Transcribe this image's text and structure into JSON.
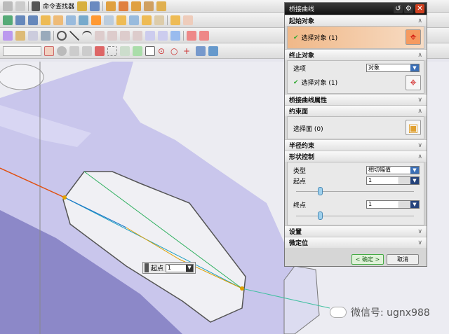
{
  "toolbar": {
    "command_finder": "命令查找器"
  },
  "dialog": {
    "title": "桥接曲线",
    "sections": {
      "start_object": "起始对象",
      "end_object": "终止对象",
      "bridge_props": "桥接曲线属性",
      "constraint_face": "约束面",
      "radius_constraint": "半径约束",
      "shape_control": "形状控制",
      "settings": "设置",
      "fine_position": "微定位"
    },
    "start_select": "选择对象 (1)",
    "end_option_label": "选项",
    "end_option_value": "对象",
    "end_select": "选择对象 (1)",
    "face_select": "选择面 (0)",
    "type_label": "类型",
    "type_value": "相切幅值",
    "start_label": "起点",
    "start_value": "1",
    "start_slider": 0.2,
    "end_label": "终点",
    "end_value": "1",
    "end_slider": 0.2,
    "ok": "< 确定 >",
    "cancel": "取消"
  },
  "float_input": {
    "label": "起点",
    "value": "1"
  },
  "watermark": "微信号: ugnx988"
}
